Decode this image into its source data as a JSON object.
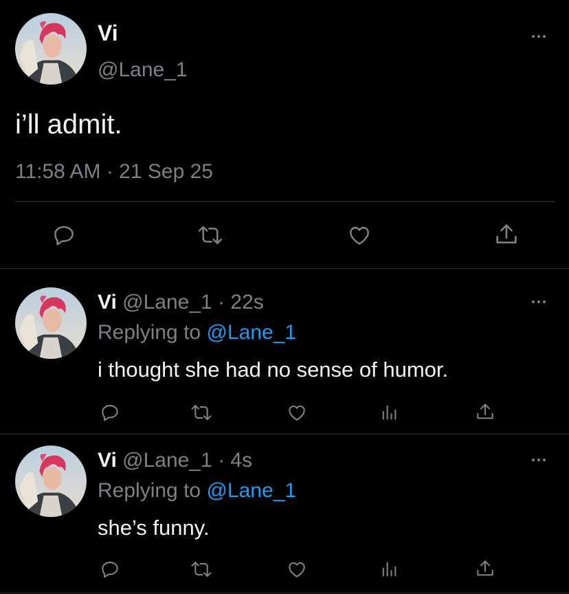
{
  "main_tweet": {
    "display_name": "Vi",
    "handle": "@Lane_1",
    "text": "i’ll admit.",
    "timestamp": "11:58 AM · 21 Sep 25",
    "icons": [
      "more-icon",
      "reply-icon",
      "retweet-icon",
      "like-icon",
      "share-icon"
    ]
  },
  "replies": [
    {
      "display_name": "Vi",
      "handle": "@Lane_1",
      "separator": "·",
      "time": "22s",
      "replying_prefix": "Replying to",
      "replying_handle": "@Lane_1",
      "text": "i thought she had no sense of humor.",
      "icons": [
        "more-icon",
        "reply-icon",
        "retweet-icon",
        "like-icon",
        "analytics-icon",
        "share-icon"
      ]
    },
    {
      "display_name": "Vi",
      "handle": "@Lane_1",
      "separator": "·",
      "time": "4s",
      "replying_prefix": "Replying to",
      "replying_handle": "@Lane_1",
      "text": "she’s funny.",
      "icons": [
        "more-icon",
        "reply-icon",
        "retweet-icon",
        "like-icon",
        "analytics-icon",
        "share-icon"
      ]
    }
  ],
  "colors": {
    "background": "#000000",
    "text": "#e7e9ea",
    "muted": "#7d8186",
    "link": "#1d9bf0",
    "divider": "#2f3336"
  }
}
